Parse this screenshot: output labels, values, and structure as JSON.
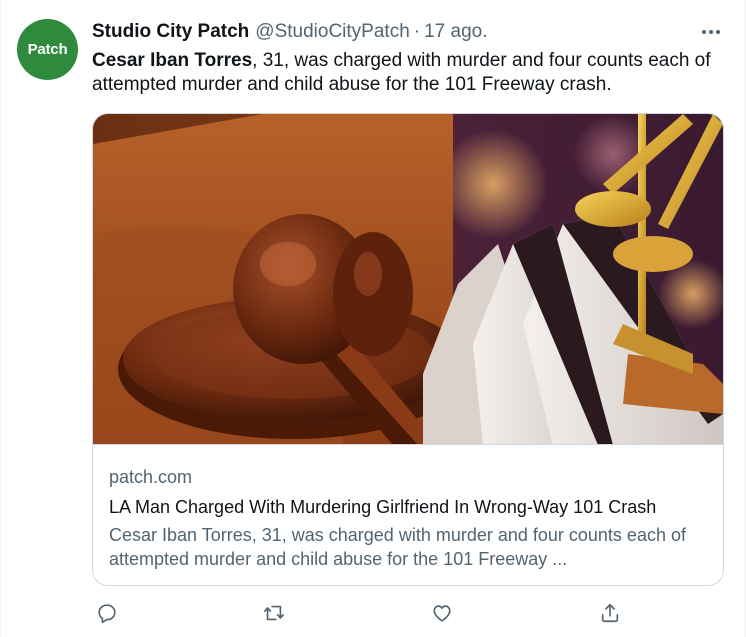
{
  "tweet": {
    "avatar_text": "Patch",
    "author_name": "Studio City Patch",
    "author_handle": "@StudioCityPatch",
    "separator": "·",
    "timestamp": "17 ago.",
    "text_bold": "Cesar Iban Torres",
    "text_rest": ", 31, was charged with murder and four counts each of attempted murder and child abuse for the 101 Freeway crash."
  },
  "card": {
    "image_icon": "gavel-and-scales-photo",
    "domain": "patch.com",
    "title": "LA Man Charged With Murdering Girlfriend In Wrong-Way 101 Crash",
    "description": "Cesar Iban Torres, 31, was charged with murder and four counts each of attempted murder and child abuse for the 101 Freeway ..."
  },
  "actions": {
    "reply_icon": "reply-icon",
    "retweet_icon": "retweet-icon",
    "like_icon": "heart-icon",
    "share_icon": "share-icon"
  },
  "colors": {
    "avatar_bg": "#2e8b3e",
    "secondary_text": "#536471",
    "border": "#cfd9de"
  }
}
